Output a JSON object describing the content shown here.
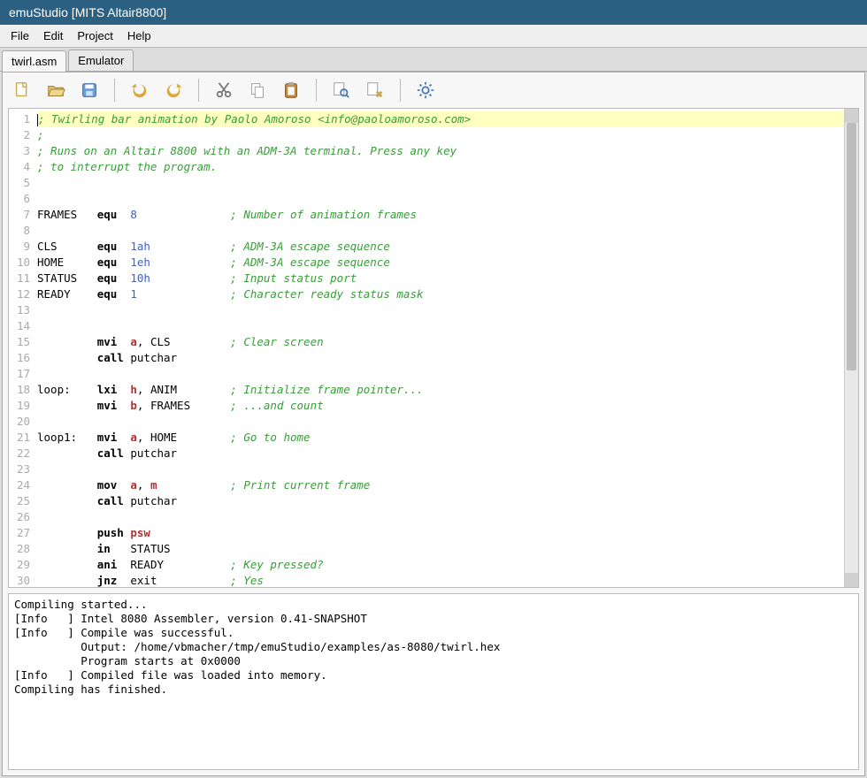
{
  "title": "emuStudio [MITS Altair8800]",
  "menu": {
    "file": "File",
    "edit": "Edit",
    "project": "Project",
    "help": "Help"
  },
  "tabs": {
    "t0": "twirl.asm",
    "t1": "Emulator"
  },
  "toolbar_icons": {
    "new": "new-file-icon",
    "open": "open-icon",
    "save": "save-icon",
    "undo": "undo-icon",
    "redo": "redo-icon",
    "cut": "cut-icon",
    "copy": "copy-icon",
    "paste": "paste-icon",
    "find": "find-icon",
    "replace": "replace-icon",
    "settings": "settings-icon"
  },
  "source": {
    "lines": [
      [
        {
          "c": "comment",
          "t": "; Twirling bar animation by Paolo Amoroso <info@paoloamoroso.com>"
        }
      ],
      [
        {
          "c": "comment",
          "t": ";"
        }
      ],
      [
        {
          "c": "comment",
          "t": "; Runs on an Altair 8800 with an ADM-3A terminal. Press any key"
        }
      ],
      [
        {
          "c": "comment",
          "t": "; to interrupt the program."
        }
      ],
      [],
      [],
      [
        {
          "c": "",
          "t": "FRAMES   "
        },
        {
          "c": "kw",
          "t": "equ"
        },
        {
          "c": "",
          "t": "  "
        },
        {
          "c": "num",
          "t": "8"
        },
        {
          "c": "",
          "t": "              "
        },
        {
          "c": "comment",
          "t": "; Number of animation frames"
        }
      ],
      [],
      [
        {
          "c": "",
          "t": "CLS      "
        },
        {
          "c": "kw",
          "t": "equ"
        },
        {
          "c": "",
          "t": "  "
        },
        {
          "c": "num",
          "t": "1ah"
        },
        {
          "c": "",
          "t": "            "
        },
        {
          "c": "comment",
          "t": "; ADM-3A escape sequence"
        }
      ],
      [
        {
          "c": "",
          "t": "HOME     "
        },
        {
          "c": "kw",
          "t": "equ"
        },
        {
          "c": "",
          "t": "  "
        },
        {
          "c": "num",
          "t": "1eh"
        },
        {
          "c": "",
          "t": "            "
        },
        {
          "c": "comment",
          "t": "; ADM-3A escape sequence"
        }
      ],
      [
        {
          "c": "",
          "t": "STATUS   "
        },
        {
          "c": "kw",
          "t": "equ"
        },
        {
          "c": "",
          "t": "  "
        },
        {
          "c": "num",
          "t": "10h"
        },
        {
          "c": "",
          "t": "            "
        },
        {
          "c": "comment",
          "t": "; Input status port"
        }
      ],
      [
        {
          "c": "",
          "t": "READY    "
        },
        {
          "c": "kw",
          "t": "equ"
        },
        {
          "c": "",
          "t": "  "
        },
        {
          "c": "num",
          "t": "1"
        },
        {
          "c": "",
          "t": "              "
        },
        {
          "c": "comment",
          "t": "; Character ready status mask"
        }
      ],
      [],
      [],
      [
        {
          "c": "",
          "t": "         "
        },
        {
          "c": "kw",
          "t": "mvi"
        },
        {
          "c": "",
          "t": "  "
        },
        {
          "c": "reg",
          "t": "a"
        },
        {
          "c": "",
          "t": ", CLS         "
        },
        {
          "c": "comment",
          "t": "; Clear screen"
        }
      ],
      [
        {
          "c": "",
          "t": "         "
        },
        {
          "c": "kw",
          "t": "call"
        },
        {
          "c": "",
          "t": " putchar"
        }
      ],
      [],
      [
        {
          "c": "",
          "t": "loop:    "
        },
        {
          "c": "kw",
          "t": "lxi"
        },
        {
          "c": "",
          "t": "  "
        },
        {
          "c": "reg",
          "t": "h"
        },
        {
          "c": "",
          "t": ", ANIM        "
        },
        {
          "c": "comment",
          "t": "; Initialize frame pointer..."
        }
      ],
      [
        {
          "c": "",
          "t": "         "
        },
        {
          "c": "kw",
          "t": "mvi"
        },
        {
          "c": "",
          "t": "  "
        },
        {
          "c": "reg",
          "t": "b"
        },
        {
          "c": "",
          "t": ", FRAMES      "
        },
        {
          "c": "comment",
          "t": "; ...and count"
        }
      ],
      [],
      [
        {
          "c": "",
          "t": "loop1:   "
        },
        {
          "c": "kw",
          "t": "mvi"
        },
        {
          "c": "",
          "t": "  "
        },
        {
          "c": "reg",
          "t": "a"
        },
        {
          "c": "",
          "t": ", HOME        "
        },
        {
          "c": "comment",
          "t": "; Go to home"
        }
      ],
      [
        {
          "c": "",
          "t": "         "
        },
        {
          "c": "kw",
          "t": "call"
        },
        {
          "c": "",
          "t": " putchar"
        }
      ],
      [],
      [
        {
          "c": "",
          "t": "         "
        },
        {
          "c": "kw",
          "t": "mov"
        },
        {
          "c": "",
          "t": "  "
        },
        {
          "c": "reg",
          "t": "a"
        },
        {
          "c": "",
          "t": ", "
        },
        {
          "c": "reg",
          "t": "m"
        },
        {
          "c": "",
          "t": "           "
        },
        {
          "c": "comment",
          "t": "; Print current frame"
        }
      ],
      [
        {
          "c": "",
          "t": "         "
        },
        {
          "c": "kw",
          "t": "call"
        },
        {
          "c": "",
          "t": " putchar"
        }
      ],
      [],
      [
        {
          "c": "",
          "t": "         "
        },
        {
          "c": "kw",
          "t": "push"
        },
        {
          "c": "",
          "t": " "
        },
        {
          "c": "reg",
          "t": "psw"
        }
      ],
      [
        {
          "c": "",
          "t": "         "
        },
        {
          "c": "kw",
          "t": "in"
        },
        {
          "c": "",
          "t": "   STATUS"
        }
      ],
      [
        {
          "c": "",
          "t": "         "
        },
        {
          "c": "kw",
          "t": "ani"
        },
        {
          "c": "",
          "t": "  READY          "
        },
        {
          "c": "comment",
          "t": "; Key pressed?"
        }
      ],
      [
        {
          "c": "",
          "t": "         "
        },
        {
          "c": "kw",
          "t": "jnz"
        },
        {
          "c": "",
          "t": "  exit           "
        },
        {
          "c": "comment",
          "t": "; Yes"
        }
      ]
    ],
    "highlight_line": 0
  },
  "console_lines": [
    "Compiling started...",
    "[Info   ] Intel 8080 Assembler, version 0.41-SNAPSHOT",
    "[Info   ] Compile was successful.",
    "          Output: /home/vbmacher/tmp/emuStudio/examples/as-8080/twirl.hex",
    "          Program starts at 0x0000",
    "[Info   ] Compiled file was loaded into memory.",
    "Compiling has finished."
  ]
}
